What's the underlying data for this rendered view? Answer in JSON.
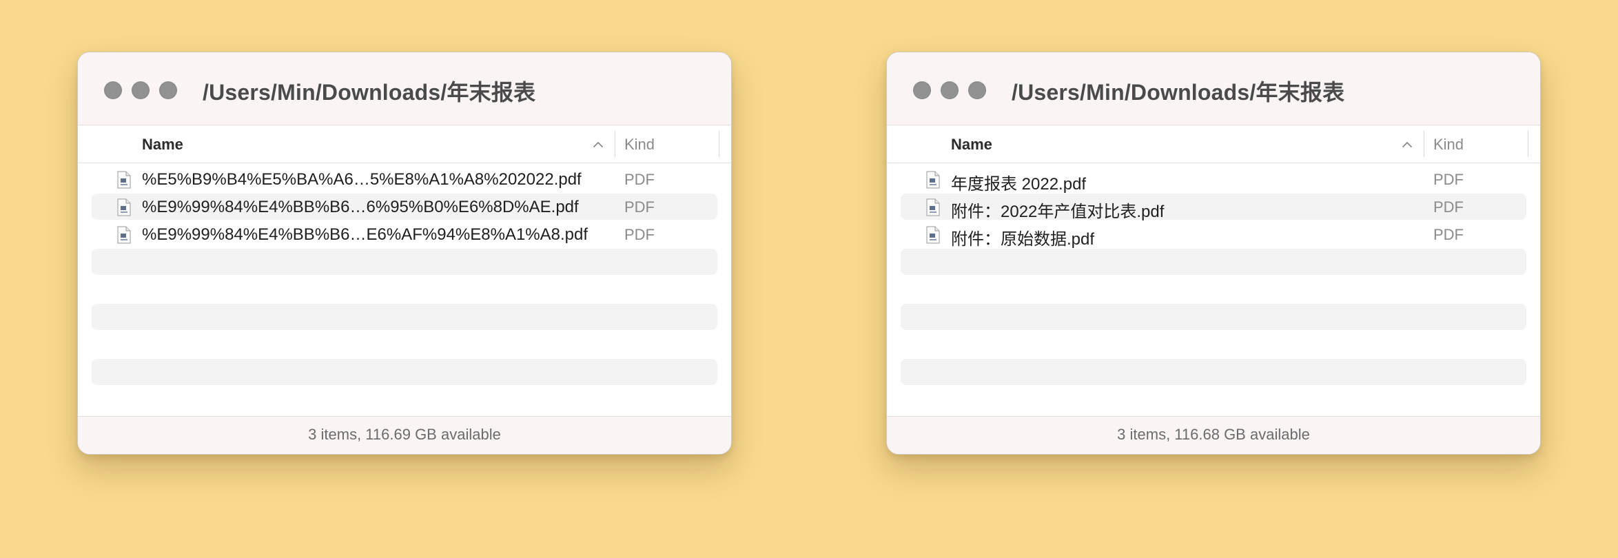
{
  "windows": [
    {
      "title": "/Users/Min/Downloads/年末报表",
      "columns": {
        "name": "Name",
        "kind": "Kind"
      },
      "files": [
        {
          "name": "%E5%B9%B4%E5%BA%A6…5%E8%A1%A8%202022.pdf",
          "kind": "PDF"
        },
        {
          "name": "%E9%99%84%E4%BB%B6…6%95%B0%E6%8D%AE.pdf",
          "kind": "PDF"
        },
        {
          "name": "%E9%99%84%E4%BB%B6…E6%AF%94%E8%A1%A8.pdf",
          "kind": "PDF"
        }
      ],
      "status": "3 items, 116.69 GB available"
    },
    {
      "title": "/Users/Min/Downloads/年末报表",
      "columns": {
        "name": "Name",
        "kind": "Kind"
      },
      "files": [
        {
          "name": "年度报表 2022.pdf",
          "kind": "PDF"
        },
        {
          "name": "附件：2022年产值对比表.pdf",
          "kind": "PDF"
        },
        {
          "name": "附件：原始数据.pdf",
          "kind": "PDF"
        }
      ],
      "status": "3 items, 116.68 GB available"
    }
  ],
  "icons": {
    "traffic_lights": [
      "close-button",
      "minimize-button",
      "zoom-button"
    ],
    "sort": "chevron-up-icon",
    "file": "pdf-file-icon"
  },
  "colors": {
    "desktop": "#f8d98e",
    "traffic_light_inactive": "#929292",
    "titlebar": "#faf5f4"
  }
}
